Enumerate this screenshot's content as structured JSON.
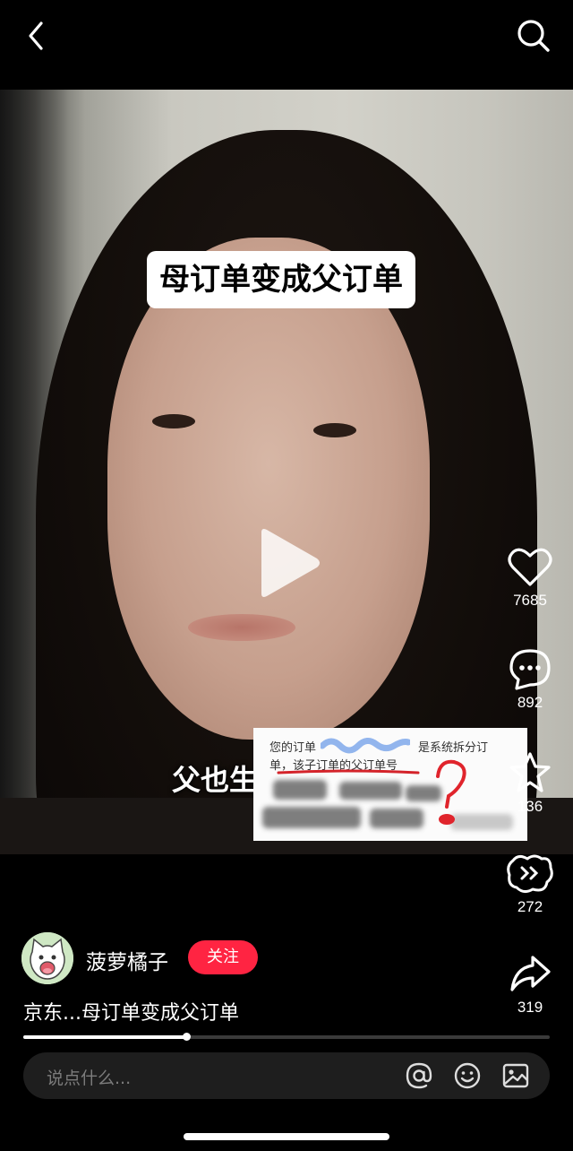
{
  "header": {
    "back_icon": "chevron-left-icon",
    "search_icon": "search-icon"
  },
  "video": {
    "title_card": "母订单变成父订单",
    "subtitle": "父也生不出来子呀",
    "play_icon": "play-icon",
    "overlay": {
      "line1_start": "您的订单",
      "line1_end": "是系统拆分订",
      "line2": "单，该子订单的父订单号"
    }
  },
  "actions": {
    "like": {
      "icon": "heart-icon",
      "count": "7685"
    },
    "comment": {
      "icon": "comment-bubble-icon",
      "count": "892"
    },
    "favorite": {
      "icon": "star-icon",
      "count": "136"
    },
    "gift": {
      "icon": "gift-badge-icon",
      "count": "272"
    },
    "share": {
      "icon": "share-arrow-icon",
      "count": "319"
    }
  },
  "author": {
    "name": "菠萝橘子",
    "follow_label": "关注"
  },
  "caption": "京东...母订单变成父订单",
  "progress": {
    "fraction": 0.31
  },
  "comment_bar": {
    "placeholder": "说点什么...",
    "icons": [
      "at-icon",
      "emoji-icon",
      "image-icon"
    ]
  },
  "colors": {
    "accent": "#ff2442",
    "background": "#000000"
  }
}
